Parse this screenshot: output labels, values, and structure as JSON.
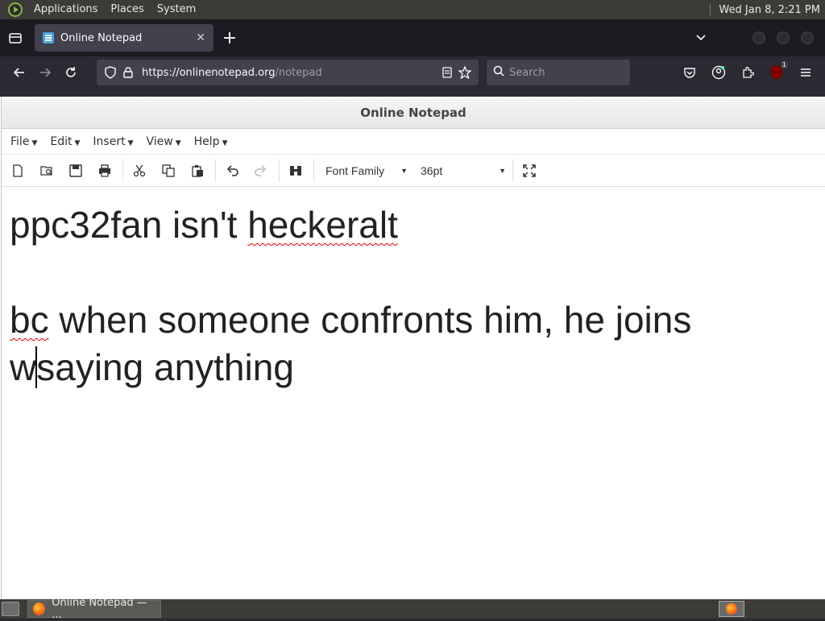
{
  "top_panel": {
    "menus": [
      "Applications",
      "Places",
      "System"
    ],
    "clock": "Wed Jan  8,  2:21 PM"
  },
  "tabstrip": {
    "active_tab_title": "Online Notepad",
    "close_glyph": "✕",
    "new_tab_glyph": "+"
  },
  "navbar": {
    "url_host": "https://onlinenotepad.org",
    "url_path": "/notepad",
    "search_placeholder": "Search",
    "ublock_badge": "1"
  },
  "app": {
    "title": "Online Notepad",
    "menus": [
      "File",
      "Edit",
      "Insert",
      "View",
      "Help"
    ],
    "font_family_label": "Font Family",
    "font_size_label": "36pt"
  },
  "document": {
    "line1_a": "ppc32fan isn't ",
    "line1_b": "heckeralt",
    "line2_a": "bc",
    "line2_b": " when someone confronts him, he joins",
    "line3_a": "w",
    "line3_b": "saying anything"
  },
  "taskbar": {
    "item_label": "Online Notepad — ..."
  },
  "colors": {
    "panel_bg": "#3c3b37",
    "browser_bg": "#1c1b22",
    "toolbar_bg": "#2b2a33",
    "spell_underline": "#d00"
  }
}
